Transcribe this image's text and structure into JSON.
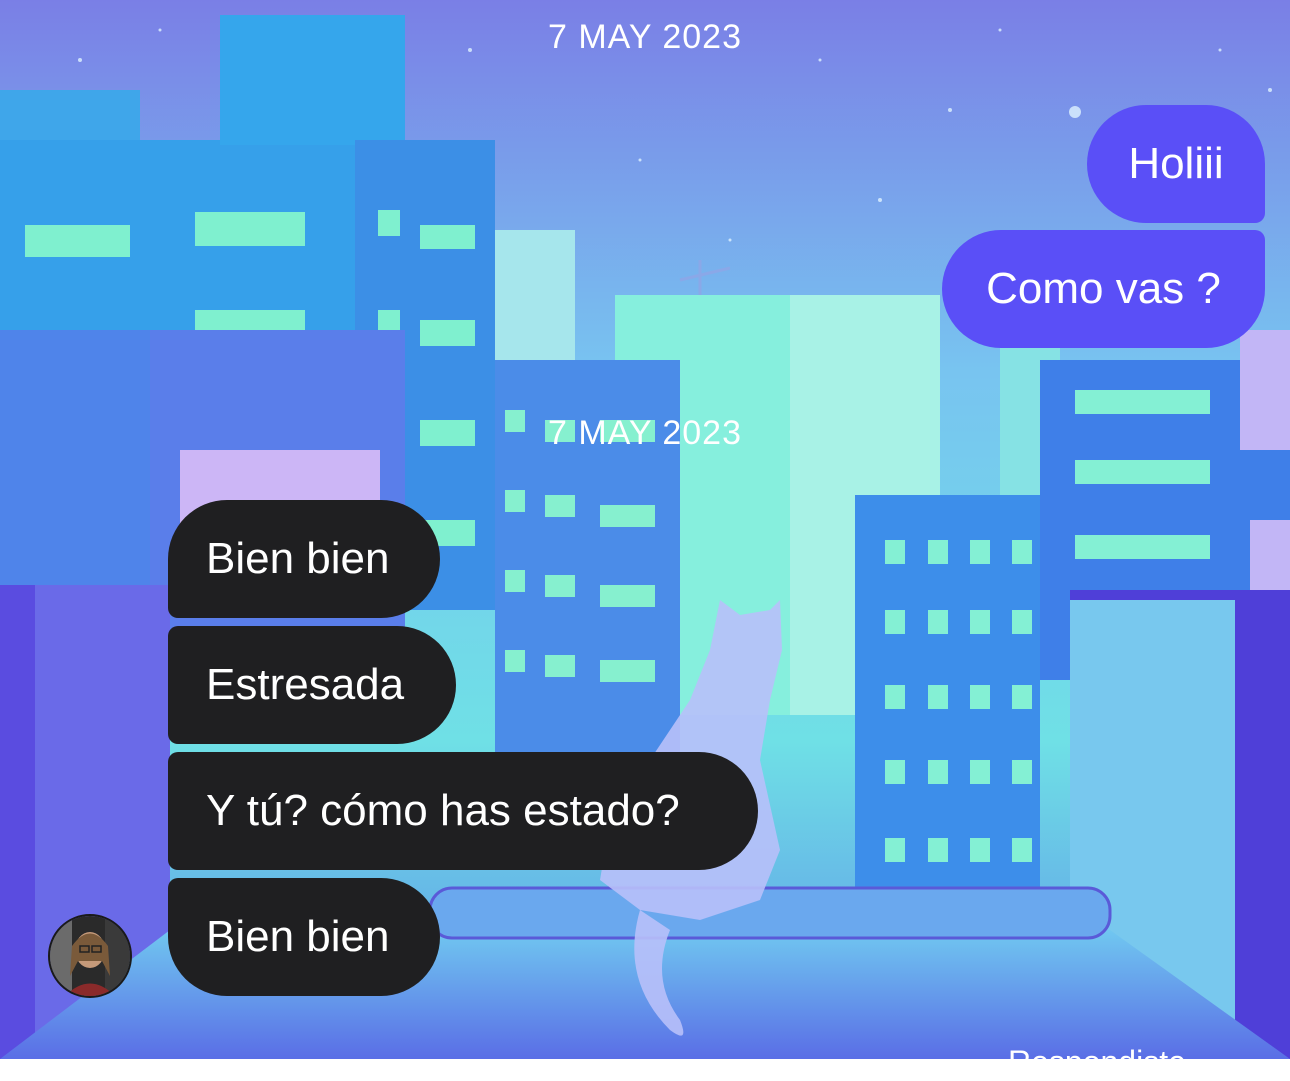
{
  "thread": {
    "date_separator_1": "7 MAY 2023",
    "date_separator_2": "7 MAY 2023",
    "sent_messages": [
      "Holiii",
      "Como vas ?"
    ],
    "received_messages": [
      "Bien bien",
      "Estresada",
      "Y tú? cómo has estado?",
      "Bien bien"
    ],
    "footer_status": "Respondiste"
  },
  "colors": {
    "sent_bubble": "#5a4ff7",
    "received_bubble": "#1f1f21",
    "text": "#ffffff"
  },
  "icons": {
    "avatar": "contact-avatar"
  }
}
